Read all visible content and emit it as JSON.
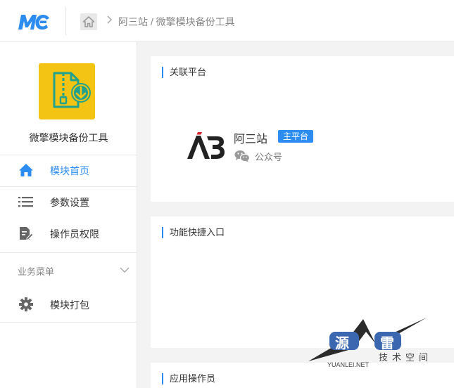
{
  "header": {
    "logo_text": "MC",
    "breadcrumb_root": "阿三站",
    "breadcrumb_separator": " / ",
    "breadcrumb_current": "微擎模块备份工具"
  },
  "sidebar": {
    "app_name": "微擎模块备份工具",
    "items": [
      {
        "label": "模块首页",
        "icon": "home-icon",
        "active": true
      },
      {
        "label": "参数设置",
        "icon": "list-icon",
        "active": false
      },
      {
        "label": "操作员权限",
        "icon": "document-edit-icon",
        "active": false
      }
    ],
    "group_label": "业务菜单",
    "group_items": [
      {
        "label": "模块打包",
        "icon": "gear-icon",
        "active": false
      }
    ]
  },
  "panels": {
    "linked_platform": {
      "title": "关联平台",
      "platform_name": "阿三站",
      "platform_tag": "主平台",
      "platform_type": "公众号"
    },
    "shortcuts": {
      "title": "功能快捷入口"
    },
    "operators": {
      "title": "应用操作员"
    }
  },
  "watermark": {
    "char_1": "源",
    "char_2": "雷",
    "subtitle": "技术空间",
    "site": "YUANLEI.NET"
  },
  "colors": {
    "accent": "#2d8cf0",
    "app_icon_bg": "#f4c414",
    "app_icon_teal": "#22a28c"
  }
}
